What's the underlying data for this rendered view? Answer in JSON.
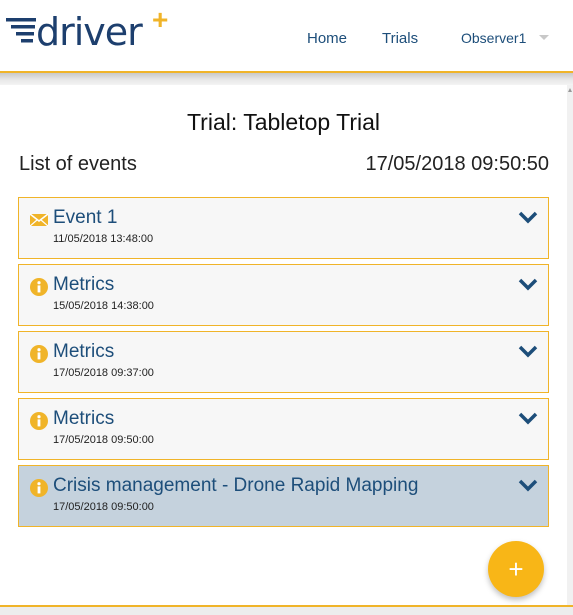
{
  "header": {
    "logo_text": "driver",
    "logo_plus": "+",
    "nav": {
      "home": "Home",
      "trials": "Trials",
      "user": "Observer1"
    }
  },
  "main": {
    "title": "Trial: Tabletop Trial",
    "list_title": "List of events",
    "current_time": "17/05/2018 09:50:50",
    "events": [
      {
        "title": "Event 1",
        "date": "11/05/2018 13:48:00",
        "icon": "envelope-icon"
      },
      {
        "title": "Metrics",
        "date": "15/05/2018 14:38:00",
        "icon": "info-icon"
      },
      {
        "title": "Metrics",
        "date": "17/05/2018 09:37:00",
        "icon": "info-icon"
      },
      {
        "title": "Metrics",
        "date": "17/05/2018 09:50:00",
        "icon": "info-icon"
      },
      {
        "title": "Crisis management - Drone Rapid Mapping",
        "date": "17/05/2018 09:50:00",
        "icon": "info-icon"
      }
    ],
    "fab_label": "+"
  },
  "colors": {
    "accent": "#f0b429",
    "brand": "#1d3f6e",
    "link": "#1d4e7a",
    "fab": "#f8b617",
    "selected_row": "#c5d2dd"
  }
}
